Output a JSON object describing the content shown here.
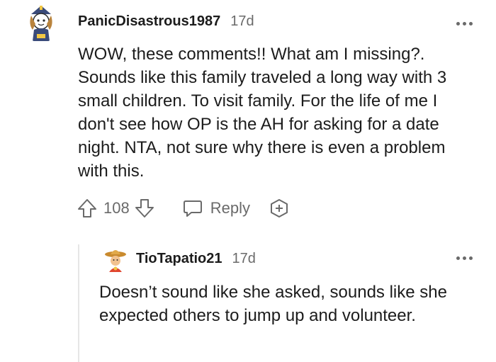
{
  "comments": [
    {
      "username": "PanicDisastrous1987",
      "time": "17d",
      "body": "WOW, these comments!! What am I missing?. Sounds like this family traveled a long way with 3 small children. To visit family. For the life of me I don't see how OP is the AH for asking for a date night. NTA, not sure why there is even a problem with this.",
      "votes": "108",
      "reply_label": "Reply"
    },
    {
      "username": "TioTapatio21",
      "time": "17d",
      "body": "Doesn’t sound like she asked, sounds like she expected others to jump up and volunteer."
    }
  ],
  "icons": {
    "upvote": "arrow-up-icon",
    "downvote": "arrow-down-icon",
    "reply": "speech-bubble-icon",
    "award": "award-plus-icon",
    "more": "more-horizontal-icon"
  },
  "colors": {
    "text": "#1c1c1c",
    "muted": "#6a6a6a",
    "thread_line": "#e6e6e6"
  }
}
